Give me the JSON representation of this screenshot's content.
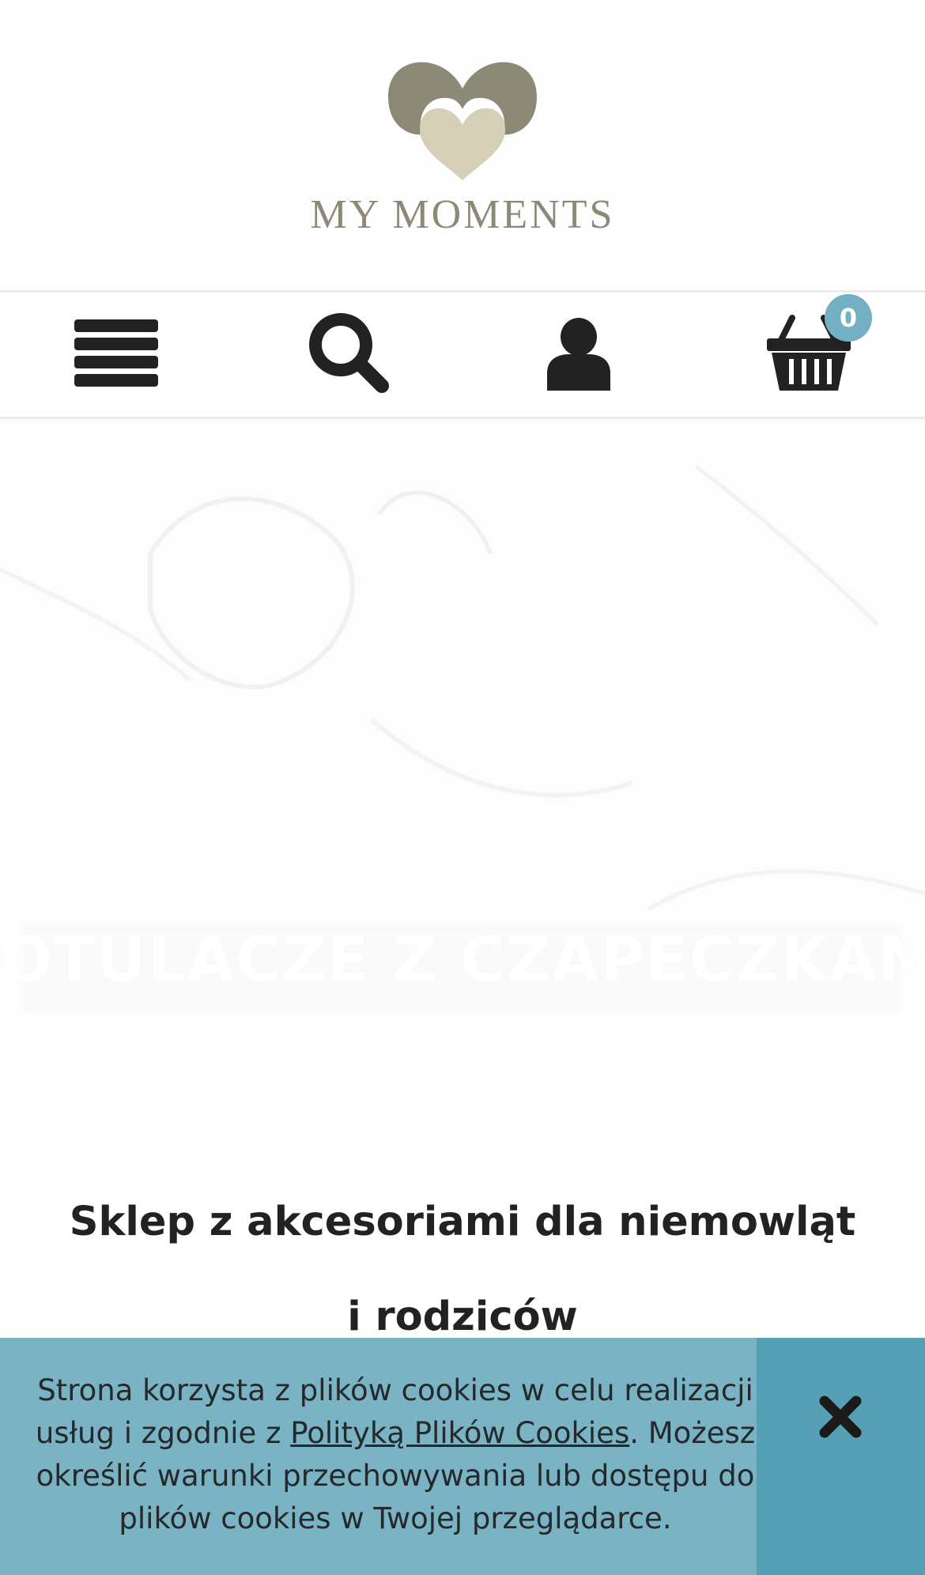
{
  "header": {
    "logo_text": "MY MOMENTS",
    "logo_colors": {
      "outer_heart": "#8c8a76",
      "inner_heart": "#d6cfb8"
    }
  },
  "nav": {
    "items": [
      {
        "icon": "menu-icon"
      },
      {
        "icon": "search-icon"
      },
      {
        "icon": "user-icon"
      },
      {
        "icon": "basket-icon"
      }
    ],
    "cart_count": "0",
    "badge_color": "#74b0c4"
  },
  "hero": {
    "title": "OTULACZE Z CZAPECZKAMI"
  },
  "main": {
    "heading": "Sklep z akcesoriami dla niemowląt i rodziców"
  },
  "cookie_banner": {
    "text_line1": "Strona korzysta z plików cookies w celu realizacji",
    "text_line2_prefix": "usług i zgodnie z ",
    "policy_link": "Polityką Plików Cookies",
    "text_line2_suffix": ". Możesz",
    "text_line3": "określić warunki przechowywania lub dostępu do",
    "text_line4": "plików cookies w Twojej przeglądarce.",
    "close_icon": "close-icon",
    "background": "#7ab3c4",
    "close_background": "#56a0b5"
  }
}
